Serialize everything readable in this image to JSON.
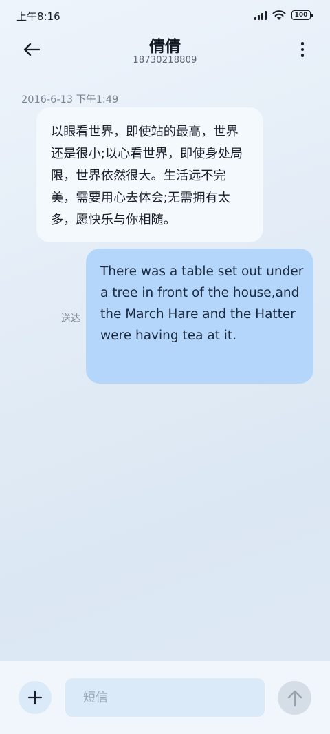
{
  "status_bar": {
    "time": "上午8:16",
    "battery": "100",
    "icons": [
      "signal-icon",
      "wifi-icon",
      "battery-icon"
    ]
  },
  "header": {
    "contact_name": "倩倩",
    "contact_number": "18730218809",
    "back_icon": "arrow-left-icon",
    "more_icon": "more-vertical-icon"
  },
  "conversation": {
    "timestamp": "2016-6-13 下午1:49",
    "messages": [
      {
        "direction": "incoming",
        "text": "以眼看世界，即使站的最高，世界还是很小;以心看世界，即使身处局限，世界依然很大。生活远不完美，需要用心去体会;无需拥有太多，愿快乐与你相随。"
      },
      {
        "direction": "outgoing",
        "text": "There was a table set out under a tree in front of the house,and the March Hare and the Hatter were having tea at it.",
        "status": "送达"
      }
    ]
  },
  "composer": {
    "placeholder": "短信",
    "value": "",
    "add_icon": "plus-icon",
    "send_icon": "arrow-up-icon"
  },
  "colors": {
    "incoming_bubble": "#f3f9fd",
    "outgoing_bubble": "#b5d6fb",
    "input_field": "#daeaf9",
    "send_button_disabled": "#d5dde6"
  }
}
